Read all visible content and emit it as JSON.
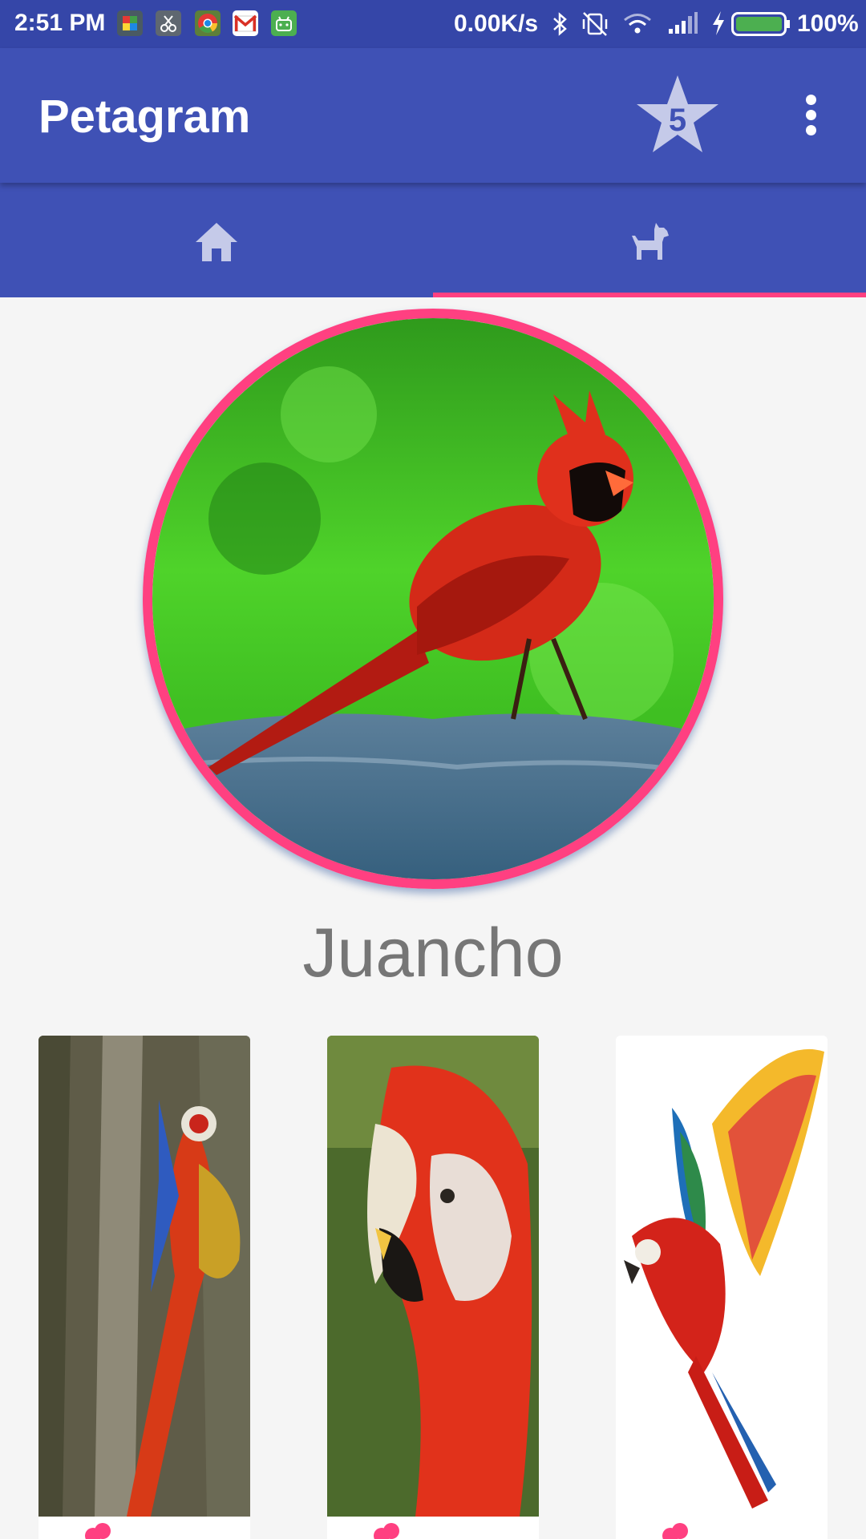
{
  "status_bar": {
    "time": "2:51 PM",
    "network_speed": "0.00K/s",
    "battery_percent": "100%",
    "notification_icons": [
      "puzzle-app-icon",
      "scissors-app-icon",
      "chrome-icon",
      "gmail-icon",
      "android-robot-icon"
    ],
    "system_icons": [
      "bluetooth-icon",
      "vibrate-off-icon",
      "wifi-icon",
      "cell-signal-icon",
      "charging-bolt-icon",
      "battery-icon"
    ]
  },
  "app_bar": {
    "title": "Petagram",
    "favorites_count": "5",
    "menu_icon": "more-vert-icon"
  },
  "tabs": [
    {
      "icon": "home-icon",
      "selected": false
    },
    {
      "icon": "dog-icon",
      "selected": true
    }
  ],
  "profile": {
    "pet_name": "Juancho",
    "avatar": "cardinal-bird-photo"
  },
  "photos": [
    {
      "image": "macaw-flying-photo"
    },
    {
      "image": "macaw-closeup-photo"
    },
    {
      "image": "macaw-wings-photo"
    }
  ],
  "colors": {
    "primary": "#3f51b5",
    "primary_dark": "#3546a8",
    "accent": "#ff4081",
    "background": "#f5f5f5",
    "name_text": "#767676"
  }
}
